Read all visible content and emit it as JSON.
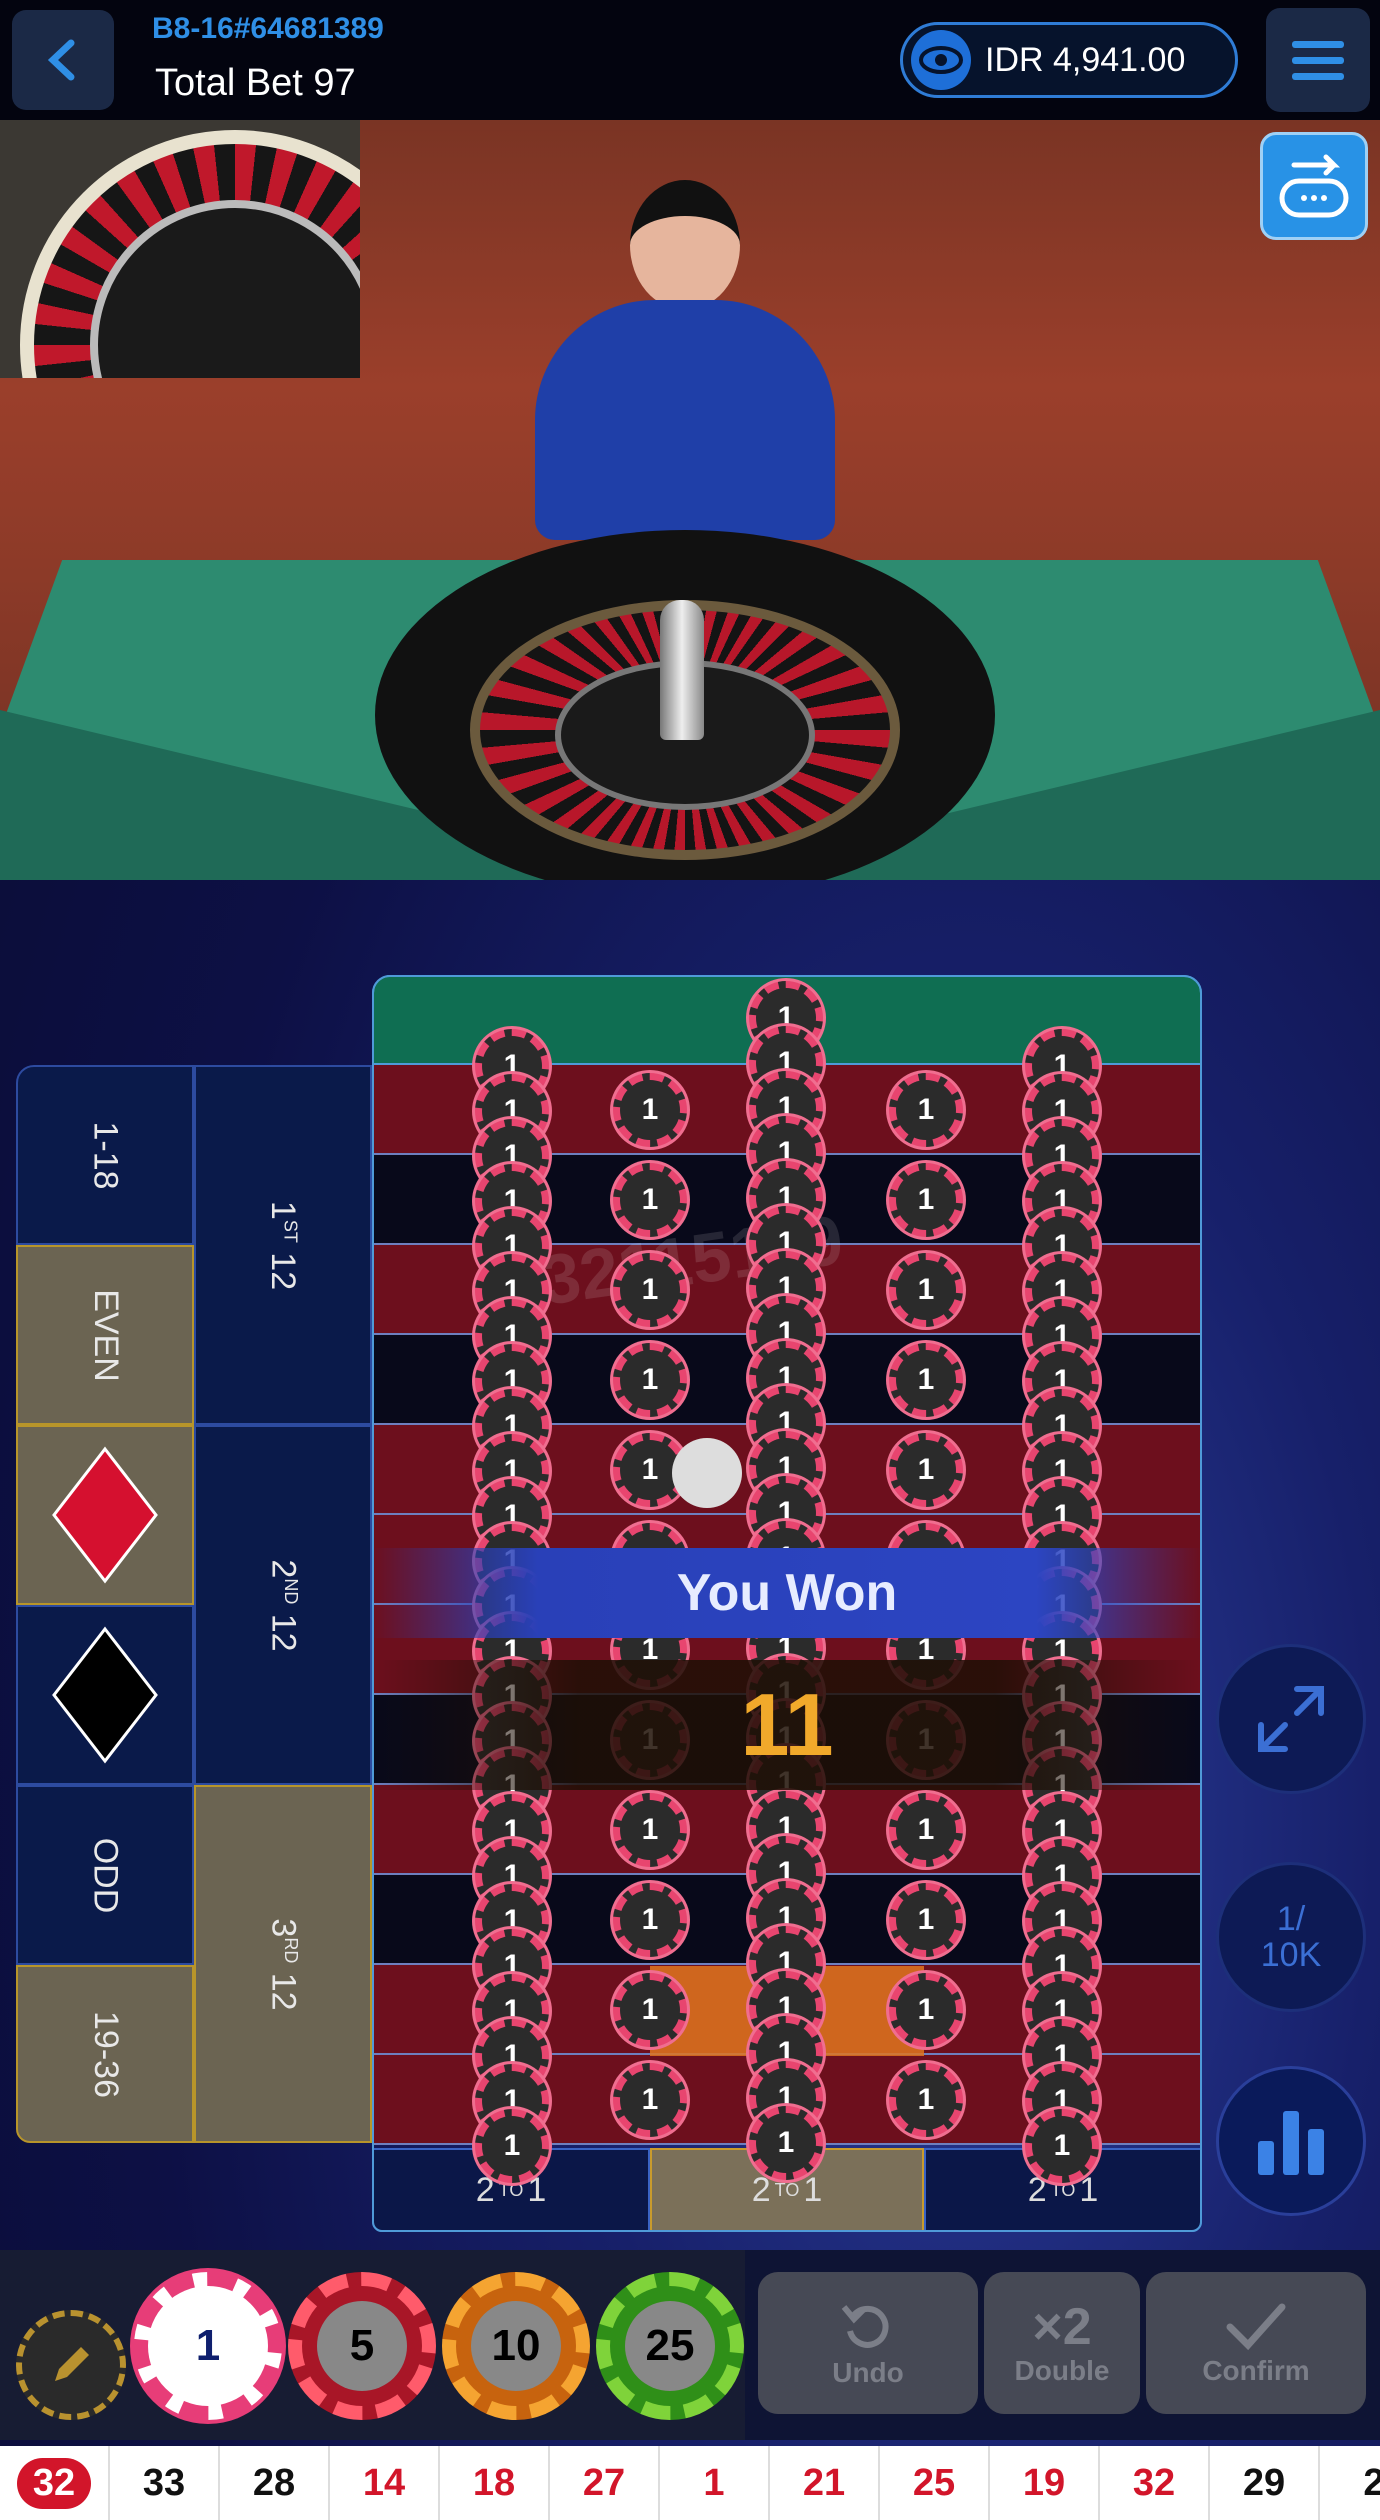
{
  "header": {
    "table_id": "B8-16#64681389",
    "total_bet": "Total Bet 97",
    "balance": "IDR 4,941.00"
  },
  "board": {
    "outside": {
      "low": "1-18",
      "even": "EVEN",
      "odd": "ODD",
      "high": "19-36"
    },
    "dozens": [
      {
        "ord": "1",
        "suffix": "ST",
        "num": "12"
      },
      {
        "ord": "2",
        "suffix": "ND",
        "num": "12"
      },
      {
        "ord": "3",
        "suffix": "RD",
        "num": "12"
      }
    ],
    "columns": [
      {
        "a": "2",
        "sup": "TO",
        "b": "1"
      },
      {
        "a": "2",
        "sup": "TO",
        "b": "1"
      },
      {
        "a": "2",
        "sup": "TO",
        "b": "1"
      }
    ],
    "chip_value": "1",
    "watermark": "32115119"
  },
  "result": {
    "banner": "You Won",
    "amount": "11"
  },
  "side_buttons": {
    "limit": "1/\n10K"
  },
  "chips": [
    "1",
    "5",
    "10",
    "25"
  ],
  "actions": {
    "undo": "Undo",
    "double_icon": "×2",
    "double": "Double",
    "confirm": "Confirm"
  },
  "history": [
    {
      "n": "32",
      "color": "red"
    },
    {
      "n": "33",
      "color": "black"
    },
    {
      "n": "28",
      "color": "black"
    },
    {
      "n": "14",
      "color": "red"
    },
    {
      "n": "18",
      "color": "red"
    },
    {
      "n": "27",
      "color": "red"
    },
    {
      "n": "1",
      "color": "red"
    },
    {
      "n": "21",
      "color": "red"
    },
    {
      "n": "25",
      "color": "red"
    },
    {
      "n": "19",
      "color": "red"
    },
    {
      "n": "32",
      "color": "red"
    },
    {
      "n": "29",
      "color": "black"
    },
    {
      "n": "2",
      "color": "black"
    }
  ],
  "colors": {
    "accent": "#2f8fe6",
    "highlight": "#b8952a",
    "win": "#f1a92b",
    "red": "#d2152a"
  }
}
